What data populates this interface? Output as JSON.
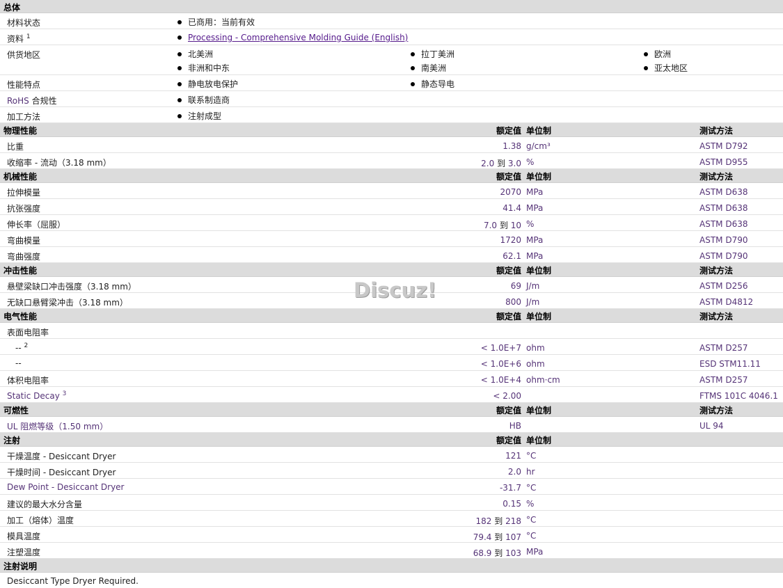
{
  "general": {
    "title": "总体",
    "status_label": "材料状态",
    "status_value": "已商用：当前有效",
    "docs_label": "资料",
    "docs_sup": "1",
    "docs_link": "Processing - Comprehensive Molding Guide (English)",
    "supply_label": "供货地区",
    "supply_regions": [
      "北美洲",
      "拉丁美洲",
      "欧洲",
      "非洲和中东",
      "南美洲",
      "亚太地区"
    ],
    "features_label": "性能特点",
    "features": [
      "静电放电保护",
      "静态导电"
    ],
    "rohs_label_a": "RoHS",
    "rohs_label_b": "合规性",
    "rohs_value": "联系制造商",
    "processing_label": "加工方法",
    "processing_value": "注射成型"
  },
  "col_headers": {
    "nominal": "额定值",
    "unit": "单位制",
    "test": "测试方法"
  },
  "physical": {
    "title": "物理性能",
    "rows": [
      {
        "label": "比重",
        "value": "1.38",
        "unit": "g/cm³",
        "test": "ASTM D792"
      },
      {
        "label": "收缩率 - 流动（3.18 mm）",
        "v1": "2.0",
        "to": "到",
        "v2": "3.0",
        "unit": "%",
        "test": "ASTM D955"
      }
    ]
  },
  "mechanical": {
    "title": "机械性能",
    "rows": [
      {
        "label": "拉伸模量",
        "value": "2070",
        "unit": "MPa",
        "test": "ASTM D638"
      },
      {
        "label": "抗张强度",
        "value": "41.4",
        "unit": "MPa",
        "test": "ASTM D638"
      },
      {
        "label": "伸长率（屈服）",
        "v1": "7.0",
        "to": "到",
        "v2": "10",
        "unit": "%",
        "test": "ASTM D638"
      },
      {
        "label": "弯曲模量",
        "value": "1720",
        "unit": "MPa",
        "test": "ASTM D790"
      },
      {
        "label": "弯曲强度",
        "value": "62.1",
        "unit": "MPa",
        "test": "ASTM D790"
      }
    ]
  },
  "impact": {
    "title": "冲击性能",
    "rows": [
      {
        "label": "悬壁梁缺口冲击强度（3.18 mm）",
        "value": "69",
        "unit": "J/m",
        "test": "ASTM D256"
      },
      {
        "label": "无缺口悬臂梁冲击（3.18 mm）",
        "value": "800",
        "unit": "J/m",
        "test": "ASTM D4812"
      }
    ]
  },
  "electrical": {
    "title": "电气性能",
    "surface_label": "表面电阻率",
    "rows": [
      {
        "label": "--",
        "sup": "2",
        "value": "< 1.0E+7",
        "unit": "ohm",
        "test": "ASTM D257"
      },
      {
        "label": "--",
        "value": "< 1.0E+6",
        "unit": "ohm",
        "test": "ESD STM11.11"
      },
      {
        "label": "体积电阻率",
        "value": "< 1.0E+4",
        "unit": "ohm·cm",
        "test": "ASTM D257"
      },
      {
        "label": "Static Decay",
        "sup": "3",
        "value": "< 2.00",
        "unit": "",
        "test": "FTMS 101C 4046.1"
      }
    ]
  },
  "flammability": {
    "title": "可燃性",
    "rows": [
      {
        "label": "UL 阻燃等级（1.50 mm）",
        "value": "HB",
        "unit": "",
        "test": "UL 94"
      }
    ]
  },
  "injection": {
    "title": "注射",
    "rows": [
      {
        "label": "干燥温度 - Desiccant Dryer",
        "value": "121",
        "unit": "°C"
      },
      {
        "label": "干燥时间 - Desiccant Dryer",
        "value": "2.0",
        "unit": "hr"
      },
      {
        "label": "Dew Point - Desiccant Dryer",
        "value": "-31.7",
        "unit": "°C"
      },
      {
        "label": "建议的最大水分含量",
        "value": "0.15",
        "unit": "%"
      },
      {
        "label": "加工（熔体）温度",
        "v1": "182",
        "to": "到",
        "v2": "218",
        "unit": "°C"
      },
      {
        "label": "模具温度",
        "v1": "79.4",
        "to": "到",
        "v2": "107",
        "unit": "°C"
      },
      {
        "label": "注塑温度",
        "v1": "68.9",
        "to": "到",
        "v2": "103",
        "unit": "MPa"
      }
    ]
  },
  "notes": {
    "title": "注射说明",
    "text": "Desiccant Type Dryer Required."
  },
  "watermark": "Discuz!"
}
